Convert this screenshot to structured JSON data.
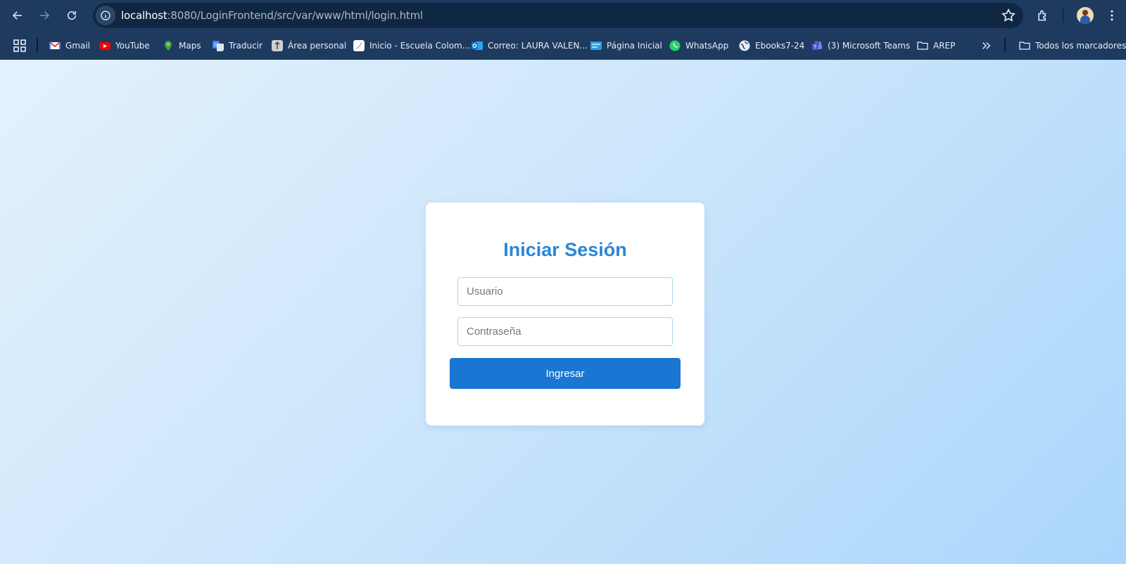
{
  "browser": {
    "url_host": "localhost",
    "url_rest": ":8080/LoginFrontend/src/var/www/html/login.html"
  },
  "bookmarks": {
    "items": [
      {
        "label": "Gmail",
        "icon": "gmail-icon",
        "color": "#ea4335"
      },
      {
        "label": "YouTube",
        "icon": "youtube-icon",
        "color": "#ff0000"
      },
      {
        "label": "Maps",
        "icon": "maps-icon",
        "color": "#34a853"
      },
      {
        "label": "Traducir",
        "icon": "translate-icon",
        "color": "#4285f4"
      },
      {
        "label": "Área personal",
        "icon": "personal-area-icon",
        "color": "#cfcfcf"
      },
      {
        "label": "Inicio - Escuela Colom...",
        "icon": "page-icon",
        "color": "#ffffff"
      },
      {
        "label": "Correo: LAURA VALEN...",
        "icon": "outlook-icon",
        "color": "#0f78d4"
      },
      {
        "label": "Página Inicial",
        "icon": "site-icon",
        "color": "#2b9fd6"
      },
      {
        "label": "WhatsApp",
        "icon": "whatsapp-icon",
        "color": "#25d366"
      },
      {
        "label": "Ebooks7-24",
        "icon": "globe-icon",
        "color": "#e8eef7"
      },
      {
        "label": "(3) Microsoft Teams",
        "icon": "teams-icon",
        "color": "#6264a7"
      },
      {
        "label": "AREP",
        "icon": "folder-icon",
        "color": "#e8eef7"
      }
    ],
    "all_bookmarks": "Todos los marcadores"
  },
  "login": {
    "title": "Iniciar Sesión",
    "username_placeholder": "Usuario",
    "username_value": "",
    "password_placeholder": "Contraseña",
    "password_value": "",
    "submit_label": "Ingresar"
  },
  "colors": {
    "title": "#2a86d6",
    "button": "#1a76d2",
    "browser_chrome": "#1e3a5f"
  }
}
